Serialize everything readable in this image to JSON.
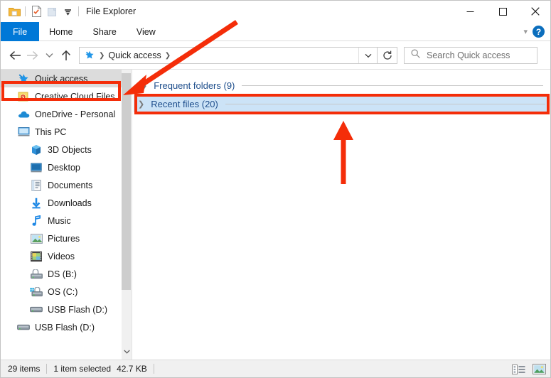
{
  "window": {
    "title": "File Explorer",
    "quick_access_toolbar": [
      {
        "name": "folder-icon",
        "label": "File Explorer"
      },
      {
        "name": "properties-icon",
        "label": "Properties"
      },
      {
        "name": "new-folder-icon",
        "label": "New folder"
      },
      {
        "name": "customize-dropdown-icon",
        "label": "Customize Quick Access Toolbar"
      }
    ],
    "controls": {
      "minimize": "Minimize",
      "maximize": "Maximize",
      "close": "Close"
    }
  },
  "ribbon": {
    "tabs": [
      {
        "label": "File",
        "active": true
      },
      {
        "label": "Home",
        "active": false
      },
      {
        "label": "Share",
        "active": false
      },
      {
        "label": "View",
        "active": false
      }
    ],
    "collapse_label": "Minimize the Ribbon",
    "help_label": "?"
  },
  "addressbar": {
    "back_label": "Back",
    "forward_label": "Forward",
    "recent_label": "Recent locations",
    "up_label": "Up",
    "breadcrumb": [
      {
        "icon": "quick-access-star-icon",
        "label": "Quick access"
      }
    ],
    "dropdown_label": "Previous locations",
    "refresh_label": "Refresh"
  },
  "search": {
    "placeholder": "Search Quick access",
    "icon": "search-icon"
  },
  "sidebar": {
    "items": [
      {
        "label": "Quick access",
        "icon": "quick-access-star-icon",
        "level": 0,
        "selected": true
      },
      {
        "label": "Creative Cloud Files",
        "icon": "creative-cloud-icon",
        "level": 0,
        "selected": false
      },
      {
        "label": "OneDrive - Personal",
        "icon": "onedrive-cloud-icon",
        "level": 0,
        "selected": false
      },
      {
        "label": "This PC",
        "icon": "this-pc-monitor-icon",
        "level": 0,
        "selected": false
      },
      {
        "label": "3D Objects",
        "icon": "3d-objects-icon",
        "level": 1,
        "selected": false
      },
      {
        "label": "Desktop",
        "icon": "desktop-icon",
        "level": 1,
        "selected": false
      },
      {
        "label": "Documents",
        "icon": "documents-icon",
        "level": 1,
        "selected": false
      },
      {
        "label": "Downloads",
        "icon": "downloads-arrow-icon",
        "level": 1,
        "selected": false
      },
      {
        "label": "Music",
        "icon": "music-note-icon",
        "level": 1,
        "selected": false
      },
      {
        "label": "Pictures",
        "icon": "pictures-icon",
        "level": 1,
        "selected": false
      },
      {
        "label": "Videos",
        "icon": "videos-film-icon",
        "level": 1,
        "selected": false
      },
      {
        "label": "DS (B:)",
        "icon": "hard-drive-icon",
        "level": 1,
        "selected": false
      },
      {
        "label": "OS (C:)",
        "icon": "windows-drive-icon",
        "level": 1,
        "selected": false
      },
      {
        "label": "USB Flash (D:)",
        "icon": "usb-drive-icon",
        "level": 1,
        "selected": false
      },
      {
        "label": "USB Flash (D:)",
        "icon": "usb-drive-icon",
        "level": 0,
        "selected": false
      }
    ],
    "scroll_down_label": "Scroll down"
  },
  "content": {
    "groups": [
      {
        "label": "Frequent folders (9)",
        "expanded": false,
        "selected": false
      },
      {
        "label": "Recent files (20)",
        "expanded": false,
        "selected": true
      }
    ]
  },
  "statusbar": {
    "item_count": "29 items",
    "selection": "1 item selected",
    "size": "42.7 KB",
    "details_view_label": "Details view",
    "large_icons_view_label": "Large icons view"
  },
  "annotations": {
    "color": "#f42d09",
    "boxes": [
      {
        "name": "quick-access-highlight"
      },
      {
        "name": "recent-files-highlight"
      }
    ],
    "arrows": [
      {
        "name": "arrow-to-quick-access"
      },
      {
        "name": "arrow-to-recent-files"
      }
    ]
  },
  "colors": {
    "accent": "#0078d7",
    "selection": "#cce3f7",
    "group_text": "#1e4e8c",
    "annotation": "#f42d09"
  }
}
